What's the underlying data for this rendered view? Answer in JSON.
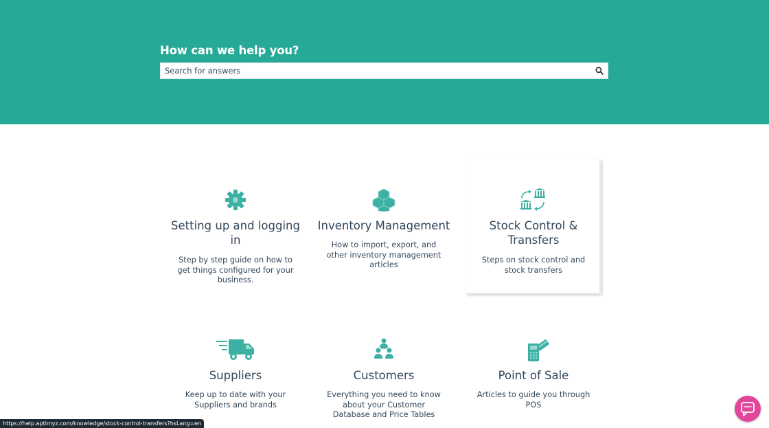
{
  "hero": {
    "title": "How can we help you?",
    "search_placeholder": "Search for answers",
    "search_icon": "search-icon"
  },
  "categories": [
    {
      "icon": "gear-icon",
      "title": "Setting up and logging in",
      "description": "Step by step guide on how to get things configured for your business."
    },
    {
      "icon": "boxes-icon",
      "title": "Inventory Management",
      "description": "How to import, export, and other inventory management articles"
    },
    {
      "icon": "transfer-icon",
      "title": "Stock Control & Transfers",
      "description": "Steps on stock control and stock transfers"
    },
    {
      "icon": "truck-icon",
      "title": "Suppliers",
      "description": "Keep up to date with your Suppliers and brands"
    },
    {
      "icon": "customers-icon",
      "title": "Customers",
      "description": "Everything you need to know about your Customer Database and Price Tables"
    },
    {
      "icon": "pos-terminal-icon",
      "title": "Point of Sale",
      "description": "Articles to guide you through POS"
    }
  ],
  "status_bar": {
    "url": "https://help.aptimyz.com/knowledge/stock-control-transfers?hsLang=en"
  },
  "chat": {
    "icon": "chat-icon"
  },
  "colors": {
    "brand": "#26a997",
    "icon": "#3bb0a3",
    "text": "#33475b",
    "chat": "#e0479a"
  }
}
